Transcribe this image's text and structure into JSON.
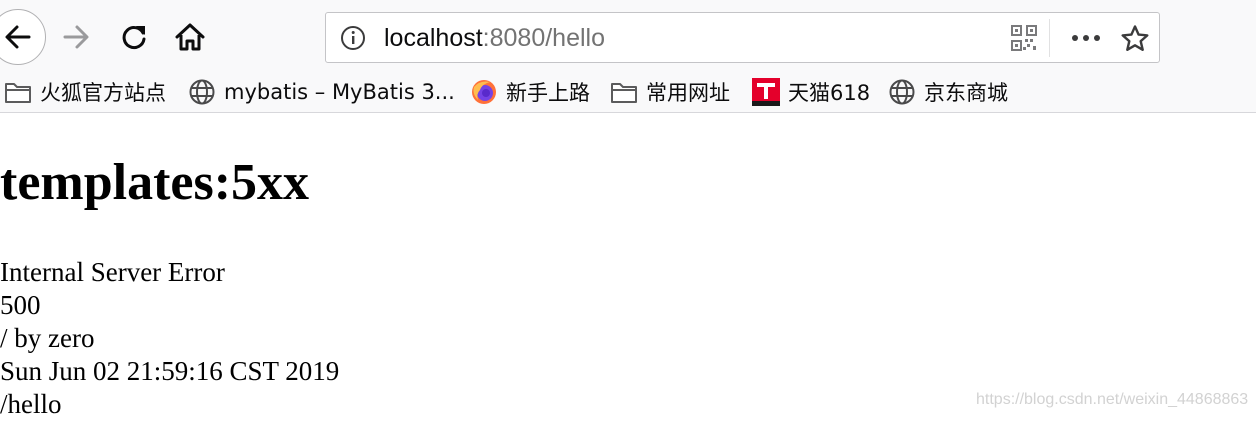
{
  "toolbar": {
    "back_icon": "arrow-left-icon",
    "forward_icon": "arrow-right-icon",
    "reload_icon": "reload-icon",
    "home_icon": "home-icon"
  },
  "urlbar": {
    "host": "localhost",
    "rest": ":8080/hello",
    "info_icon": "info-icon",
    "qr_icon": "qr-code-icon",
    "more_icon": "more-dots-icon",
    "star_icon": "star-icon"
  },
  "bookmarks": [
    {
      "label": "火狐官方站点",
      "icon": "folder-icon"
    },
    {
      "label": "mybatis – MyBatis 3...",
      "icon": "globe-icon"
    },
    {
      "label": "新手上路",
      "icon": "firefox-icon"
    },
    {
      "label": "常用网址",
      "icon": "folder-icon"
    },
    {
      "label": "天猫618",
      "icon": "tmall-icon"
    },
    {
      "label": "京东商城",
      "icon": "globe-icon"
    }
  ],
  "page": {
    "heading": "templates:5xx",
    "lines": [
      "Internal Server Error",
      "500",
      "/ by zero",
      "Sun Jun 02 21:59:16 CST 2019",
      "/hello"
    ],
    "watermark": "https://blog.csdn.net/weixin_44868863"
  },
  "colors": {
    "toolbar_bg": "#f9f9fa",
    "firefox_orange": "#ff7139",
    "tmall_red": "#e4002b"
  }
}
